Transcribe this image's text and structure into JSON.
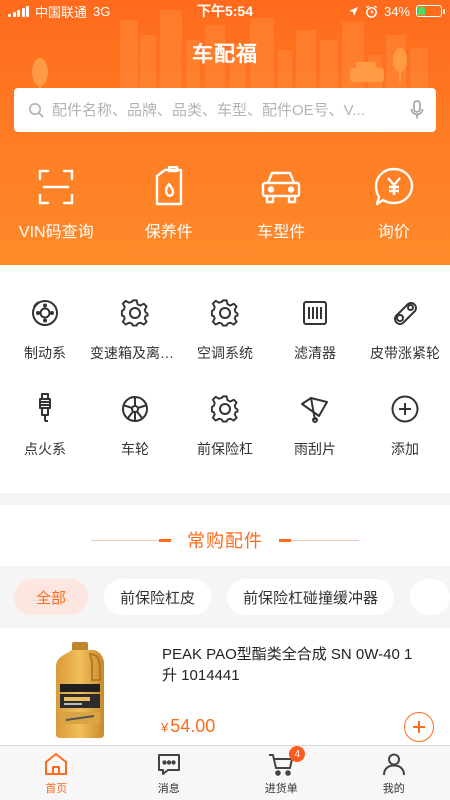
{
  "status_bar": {
    "carrier": "中国联通",
    "network": "3G",
    "time": "下午5:54",
    "battery": "34%",
    "battery_level": 0.34
  },
  "header": {
    "title": "车配福",
    "search_placeholder": "配件名称、品牌、品类、车型、配件OE号、V..."
  },
  "quick_actions": [
    {
      "label": "VIN码查询",
      "icon": "scan-icon"
    },
    {
      "label": "保养件",
      "icon": "oil-can-icon"
    },
    {
      "label": "车型件",
      "icon": "car-icon"
    },
    {
      "label": "询价",
      "icon": "yen-bubble-icon"
    }
  ],
  "categories": [
    {
      "label": "制动系",
      "icon": "brake-disc-icon"
    },
    {
      "label": "变速箱及离合器",
      "icon": "gear-icon"
    },
    {
      "label": "空调系统",
      "icon": "gear-icon"
    },
    {
      "label": "滤清器",
      "icon": "filter-icon"
    },
    {
      "label": "皮带涨紧轮",
      "icon": "belt-tensioner-icon"
    },
    {
      "label": "点火系",
      "icon": "spark-plug-icon"
    },
    {
      "label": "车轮",
      "icon": "wheel-icon"
    },
    {
      "label": "前保险杠",
      "icon": "gear-icon"
    },
    {
      "label": "雨刮片",
      "icon": "wiper-icon"
    },
    {
      "label": "添加",
      "icon": "add-circle-icon"
    }
  ],
  "frequent": {
    "title": "常购配件",
    "tabs": [
      "全部",
      "前保险杠皮",
      "前保险杠碰撞缓冲器"
    ],
    "product": {
      "name": "PEAK PAO型酯类全合成    SN 0W-40 1升 1014441",
      "currency": "¥",
      "price": "54.00"
    }
  },
  "bottom_nav": [
    {
      "label": "首页",
      "icon": "home-icon",
      "active": true
    },
    {
      "label": "消息",
      "icon": "message-icon"
    },
    {
      "label": "进货单",
      "icon": "cart-icon",
      "badge": "4"
    },
    {
      "label": "我的",
      "icon": "user-icon"
    }
  ],
  "colors": {
    "accent": "#ff6a1c",
    "text": "#333333",
    "background": "#f5f5f5"
  }
}
